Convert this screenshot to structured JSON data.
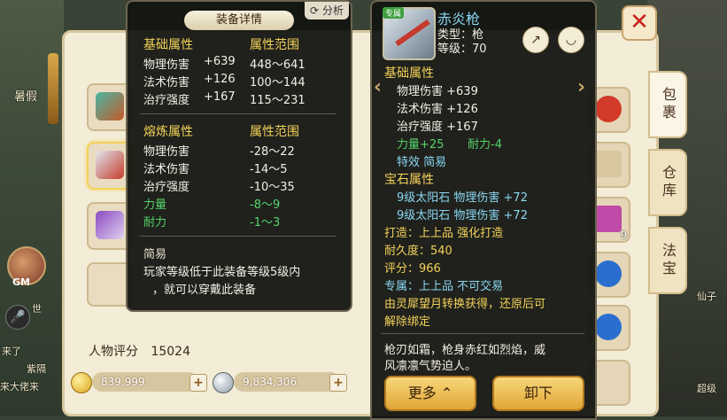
{
  "scene": {
    "left_texts": [
      "暑假",
      "GM",
      "世",
      "来了",
      "紫隔",
      "来大佬来"
    ],
    "right_texts": [
      "仙子",
      "超级"
    ]
  },
  "left_tooltip": {
    "tab_label": "装备详情",
    "analyze_label": "分析",
    "base_section": {
      "header": "基础属性",
      "range_header": "属性范围",
      "rows": [
        {
          "name": "物理伤害",
          "value": "+639",
          "range": "448～641"
        },
        {
          "name": "法术伤害",
          "value": "+126",
          "range": "100～144"
        },
        {
          "name": "治疗强度",
          "value": "+167",
          "range": "115～231"
        }
      ]
    },
    "refine_section": {
      "header": "熔炼属性",
      "range_header": "属性范围",
      "rows": [
        {
          "name": "物理伤害",
          "range": "-28～22"
        },
        {
          "name": "法术伤害",
          "range": "-14～5"
        },
        {
          "name": "治疗强度",
          "range": "-10～35"
        },
        {
          "name": "力量",
          "range": "-8～9"
        },
        {
          "name": "耐力",
          "range": "-1～3"
        }
      ]
    },
    "easy": {
      "title": "简易",
      "desc_line1": "玩家等级低于此装备等级5级内",
      "desc_line2": "，就可以穿戴此装备"
    }
  },
  "right_tooltip": {
    "item_name": "赤炎枪",
    "bind_tag": "专属",
    "type_text": "类型：枪",
    "level_text": "等级：70",
    "base_header": "基础属性",
    "base_rows": [
      "物理伤害 +639",
      "法术伤害 +126",
      "治疗强度 +167"
    ],
    "str_text": "力量+25",
    "sta_text": "耐力-4",
    "effect_text": "特效  简易",
    "gem_header": "宝石属性",
    "gem_rows": [
      "9级太阳石  物理伤害 +72",
      "9级太阳石  物理伤害 +72"
    ],
    "forge_text": "打造：上上品    强化打造",
    "durability_text": "耐久度：540",
    "score_text": "评分：966",
    "exclusive_text": "专属：上上品    不可交易",
    "origin_line1": "由灵犀望月转换获得，还原后可",
    "origin_line2": "解除绑定",
    "flavor_line1": "枪刃如霜，枪身赤红如烈焰，威",
    "flavor_line2": "风凛凛气势迫人。",
    "more_label": "更多",
    "unequip_label": "卸下"
  },
  "bag": {
    "score_label": "人物评分",
    "score_value": "15024",
    "gold": "839,999",
    "silver": "9,834,306",
    "tabs": [
      "包裹",
      "仓库",
      "法宝"
    ],
    "right_slot_badge": "9"
  },
  "colors": {
    "gold": "#f3d35a",
    "green": "#55d36b",
    "cyan": "#89d7f2",
    "close_red": "#c8231b"
  }
}
